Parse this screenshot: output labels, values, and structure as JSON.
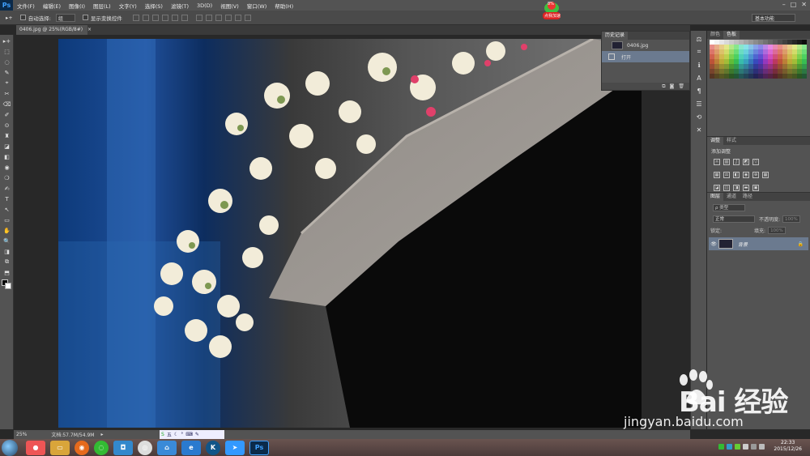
{
  "app": {
    "logo": "Ps"
  },
  "menu": [
    "文件(F)",
    "编辑(E)",
    "图像(I)",
    "图层(L)",
    "文字(Y)",
    "选择(S)",
    "滤镜(T)",
    "3D(D)",
    "视图(V)",
    "窗口(W)",
    "帮助(H)"
  ],
  "window_controls": [
    "–",
    "□",
    "✕"
  ],
  "options": {
    "auto_select_label": "自动选择:",
    "auto_select_value": "组",
    "show_transform_label": "显示变换控件",
    "workspace": "基本功能"
  },
  "badge": {
    "text": "点我加速",
    "num": "8%"
  },
  "document": {
    "tab_label": "0406.jpg @ 25%(RGB/8#)",
    "close": "×"
  },
  "tools": [
    "▸+",
    "⬚",
    "◌",
    "✎",
    "⌖",
    "✂",
    "⌫",
    "✐",
    "⊙",
    "♜",
    "◪",
    "◧",
    "◉",
    "❍",
    "✍",
    "T",
    "↖",
    "▭",
    "✋",
    "🔍",
    "◨",
    "⧉",
    "⬒"
  ],
  "right_strip": [
    "⚖",
    "⌗",
    "ℹ",
    "A",
    "¶",
    "☰",
    "⟲",
    "✕"
  ],
  "history": {
    "tabs": [
      "历史记录"
    ],
    "items": [
      {
        "label": "0406.jpg"
      },
      {
        "label": "打开"
      }
    ]
  },
  "color_panel": {
    "tabs": [
      "颜色",
      "色板"
    ]
  },
  "adjust_panel": {
    "tabs": [
      "调整",
      "样式"
    ],
    "title": "添加调整"
  },
  "layers_panel": {
    "tabs": [
      "图层",
      "通道",
      "路径"
    ],
    "kind_label": "ρ 类型",
    "blend_mode": "正常",
    "opacity_label": "不透明度:",
    "opacity_value": "100%",
    "lock_label": "锁定:",
    "fill_label": "填充:",
    "fill_value": "100%",
    "layer_name": "背景"
  },
  "status": {
    "zoom": "25%",
    "doc_size": "文档:57.7M/54.9M",
    "arrow": "▸"
  },
  "ime": {
    "label": "五"
  },
  "taskbar": {
    "time": "22:33",
    "date": "2015/12/26"
  },
  "watermark": {
    "brand": "Bai  经验",
    "url": "jingyan.baidu.com"
  },
  "colors": {
    "accent": "#6b7a8f",
    "panel": "#535353",
    "canvas": "#282828"
  }
}
